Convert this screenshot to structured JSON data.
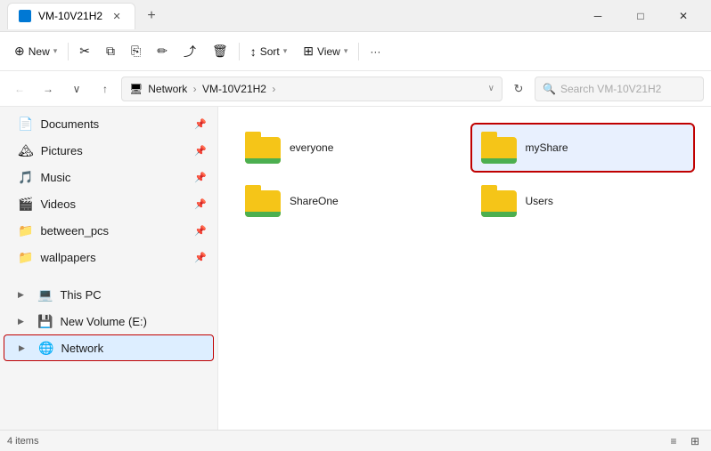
{
  "window": {
    "title": "VM-10V21H2",
    "tab_icon": "🖥",
    "close_label": "✕",
    "minimize_label": "─",
    "maximize_label": "□",
    "new_tab_label": "+"
  },
  "toolbar": {
    "new_label": "New",
    "cut_icon": "✂",
    "copy_icon": "⧉",
    "paste_icon": "📋",
    "rename_icon": "✏",
    "share_icon": "⤴",
    "delete_icon": "🗑",
    "sort_label": "Sort",
    "view_label": "View",
    "more_label": "···"
  },
  "address": {
    "back_icon": "←",
    "forward_icon": "→",
    "down_icon": "∨",
    "up_icon": "↑",
    "crumb_icon": "🖥",
    "crumb1": "Network",
    "crumb2": "VM-10V21H2",
    "dropdown_icon": "∨",
    "refresh_icon": "↻",
    "search_placeholder": "Search VM-10V21H2",
    "search_icon": "🔍"
  },
  "sidebar": {
    "items": [
      {
        "id": "documents",
        "label": "Documents",
        "icon": "📄",
        "pin": true
      },
      {
        "id": "pictures",
        "label": "Pictures",
        "icon": "🏔",
        "pin": true
      },
      {
        "id": "music",
        "label": "Music",
        "icon": "🎵",
        "pin": true
      },
      {
        "id": "videos",
        "label": "Videos",
        "icon": "🎬",
        "pin": true
      },
      {
        "id": "between_pcs",
        "label": "between_pcs",
        "icon": "📁",
        "pin": true
      },
      {
        "id": "wallpapers",
        "label": "wallpapers",
        "icon": "📁",
        "pin": true
      },
      {
        "id": "this_pc",
        "label": "This PC",
        "icon": "💻",
        "expander": "▶",
        "pin": false
      },
      {
        "id": "new_volume",
        "label": "New Volume (E:)",
        "icon": "─",
        "expander": "▶",
        "pin": false
      },
      {
        "id": "network",
        "label": "Network",
        "icon": "🌐",
        "expander": "▶",
        "pin": false,
        "active": true
      }
    ]
  },
  "files": {
    "items": [
      {
        "id": "everyone",
        "name": "everyone",
        "selected": false
      },
      {
        "id": "myShare",
        "name": "myShare",
        "selected": true
      },
      {
        "id": "ShareOne",
        "name": "ShareOne",
        "selected": false
      },
      {
        "id": "Users",
        "name": "Users",
        "selected": false
      }
    ]
  },
  "status": {
    "count": "4 items",
    "list_view_icon": "≡",
    "grid_view_icon": "⊞"
  }
}
